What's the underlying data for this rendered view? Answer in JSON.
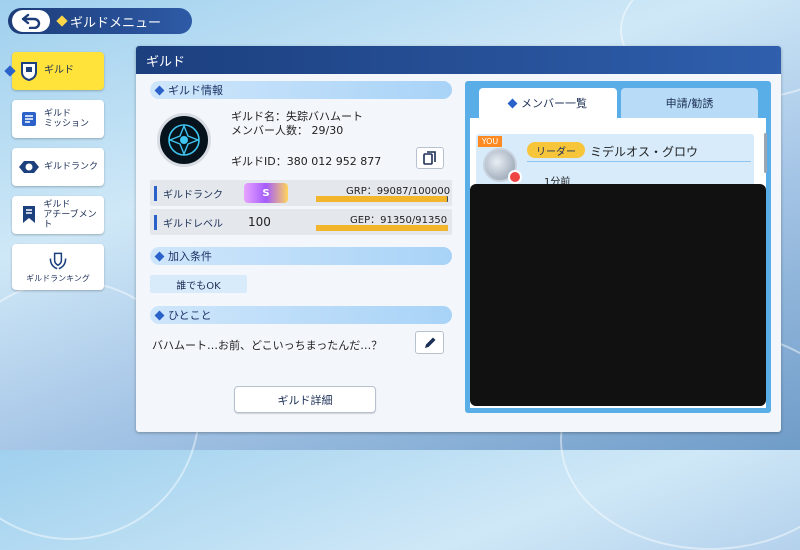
{
  "header": {
    "title": "ギルドメニュー"
  },
  "sidebar": {
    "items": [
      {
        "label": "ギルド",
        "active": true,
        "icon": "guild-shield-icon"
      },
      {
        "label": "ギルド\nミッション",
        "active": false,
        "icon": "scroll-icon"
      },
      {
        "label": "ギルドランク",
        "active": false,
        "icon": "rank-emblem-icon"
      },
      {
        "label": "ギルド\nアチーブメント",
        "active": false,
        "icon": "banner-icon"
      },
      {
        "label": "ギルドランキング",
        "active": false,
        "icon": "laurel-shield-icon"
      }
    ]
  },
  "panel": {
    "title": "ギルド"
  },
  "info": {
    "section_title": "ギルド情報",
    "guild_name": "ギルド名：失踪バハムート",
    "members": "メンバー人数： 29/30",
    "guild_id": "ギルドID：380 012 952 877"
  },
  "rank": {
    "label": "ギルドランク",
    "badge": "S",
    "grp_text": "GRP：99087/100000",
    "grp_fraction": 0.99
  },
  "level": {
    "label": "ギルドレベル",
    "value": "100",
    "gep_text": "GEP：91350/91350",
    "gep_fraction": 1.0
  },
  "conditions": {
    "section_title": "加入条件",
    "value": "誰でもOK"
  },
  "comment": {
    "section_title": "ひとこと",
    "text": "バハムート…お前、どこいっちまったんだ…？"
  },
  "detail_button": "ギルド詳細",
  "tabs": {
    "members": "メンバー一覧",
    "requests": "申請/勧誘"
  },
  "member": {
    "you_tag": "YOU",
    "role": "リーダー",
    "name": "ミデルオス・グロウ",
    "last_seen": "1分前"
  },
  "colors": {
    "accent": "#2a62c9",
    "header": "#1c3f7e",
    "active_nav": "#ffe23a",
    "bar_fill": "#f3b52a"
  }
}
